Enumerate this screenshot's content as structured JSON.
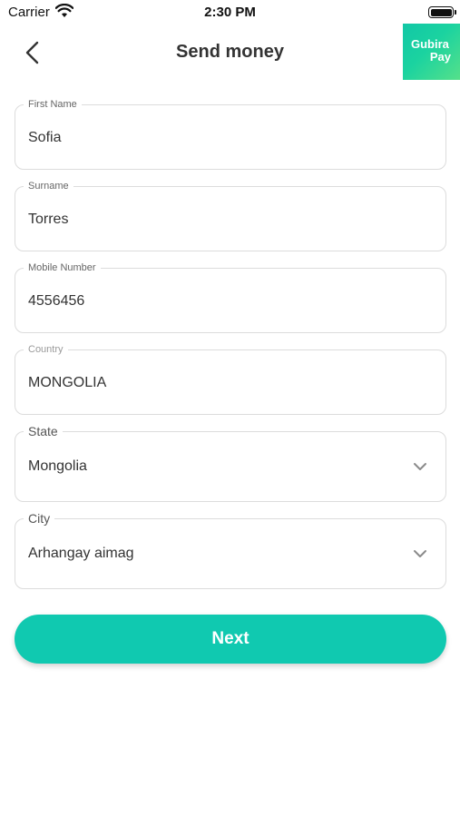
{
  "status_bar": {
    "carrier": "Carrier",
    "time": "2:30 PM"
  },
  "header": {
    "title": "Send money",
    "logo_line1": "Gubira",
    "logo_line2": "Pay",
    "back_icon": "chevron-left-icon"
  },
  "form": {
    "first_name": {
      "label": "First Name",
      "value": "Sofia"
    },
    "surname": {
      "label": "Surname",
      "value": "Torres"
    },
    "mobile": {
      "label": "Mobile Number",
      "value": "4556456"
    },
    "country": {
      "label": "Country",
      "value": "MONGOLIA"
    },
    "state": {
      "label": "State",
      "value": "Mongolia",
      "icon": "chevron-down-icon"
    },
    "city": {
      "label": "City",
      "value": "Arhangay aimag",
      "icon": "chevron-down-icon"
    }
  },
  "actions": {
    "next_label": "Next"
  },
  "colors": {
    "accent": "#10c9b0",
    "logo_gradient_start": "#12c7a6",
    "logo_gradient_end": "#55e08a",
    "border": "#dcdcdc"
  }
}
